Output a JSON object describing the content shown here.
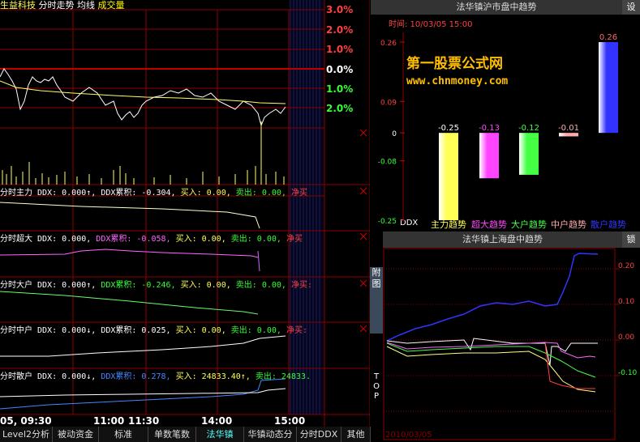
{
  "header": {
    "stock": "生益科技",
    "mode": "分时走势",
    "ma": "均线",
    "vol": "成交量"
  },
  "pct_labels": [
    "3.0%",
    "2.0%",
    "1.0%",
    "0.0%",
    "1.0%",
    "2.0%"
  ],
  "panels": [
    {
      "name": "分时主力",
      "ddx": "DDX: 0.000↑,",
      "cum": "DDX累积: -0.304,",
      "buy": "买入: 0.00,",
      "sell": "卖出: 0.00,",
      "net": "净买"
    },
    {
      "name": "分时超大",
      "ddx": "DDX: 0.000,",
      "cum": "DDX累积: -0.058,",
      "buy": "买入: 0.00,",
      "sell": "卖出: 0.00,",
      "net": "净买"
    },
    {
      "name": "分时大户",
      "ddx": "DDX: 0.000↑,",
      "cum": "DDX累积: -0.246,",
      "buy": "买入: 0.00,",
      "sell": "卖出: 0.00,",
      "net": "净买:"
    },
    {
      "name": "分时中户",
      "ddx": "DDX: 0.000↓,",
      "cum": "DDX累积: 0.025,",
      "buy": "买入: 0.00,",
      "sell": "卖出: 0.00,",
      "net": "净买:"
    },
    {
      "name": "分时散户",
      "ddx": "DDX: 0.000↓,",
      "cum": "DDX累积: 0.278,",
      "buy": "买入: 24833.40↑,",
      "sell": "卖出: 24833.",
      "net": ""
    }
  ],
  "times": [
    "05, 09:30",
    "11:00",
    "11:30",
    "14:00",
    "15:00"
  ],
  "tabs": [
    "Level2分析",
    "被动资金",
    "标准",
    "单数笔数",
    "法华镇",
    "华镇动态分",
    "分时DDX",
    "其他"
  ],
  "right_top": {
    "title": "法华镇沪市盘中趋势",
    "settings": "设",
    "time_label": "时间: 10/03/05 15:00",
    "watermark_1": "第一股票公式网",
    "watermark_2": "www.chnmoney.com",
    "ddx": "DDX",
    "side_tabs": [
      "附",
      "图",
      "T",
      "O",
      "P"
    ]
  },
  "chart_data": [
    {
      "type": "bar",
      "title": "法华镇沪市盘中趋势",
      "categories": [
        "主力趋势",
        "超大趋势",
        "大户趋势",
        "中户趋势",
        "散户趋势"
      ],
      "values": [
        -0.25,
        -0.13,
        -0.12,
        -0.01,
        0.26
      ],
      "value_labels": [
        "-0.25",
        "-0.13",
        "-0.12",
        "-0.01",
        "0.26"
      ],
      "yticks": [
        "0.26",
        "0.09",
        "0",
        "-0.08",
        "-0.25"
      ],
      "ylim": [
        -0.25,
        0.26
      ],
      "colors": [
        "#ffff55",
        "#ff44ff",
        "#44ff44",
        "#ffaaaa",
        "#3333ff"
      ]
    },
    {
      "type": "line",
      "title": "法华镇上海盘中趋势",
      "lock": "锁",
      "yticks": [
        "0.20",
        "0.10",
        "0.00",
        "-0.10"
      ],
      "xlabel": "2010/03/05"
    }
  ]
}
